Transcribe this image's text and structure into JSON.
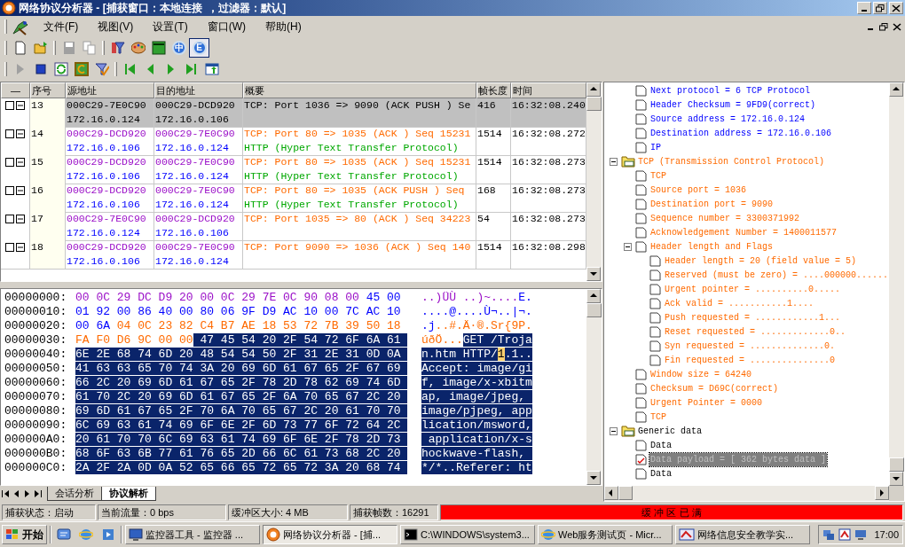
{
  "window": {
    "title": "网络协议分析器 - [捕获窗口：本地连接  ，过滤器：默认]"
  },
  "menu": [
    "文件(F)",
    "视图(V)",
    "设置(T)",
    "窗口(W)",
    "帮助(H)"
  ],
  "toolbar1": [
    [
      {
        "kind": "new",
        "disabled": false,
        "pressed": false
      },
      {
        "kind": "open",
        "disabled": false,
        "pressed": false
      }
    ],
    [
      {
        "kind": "save",
        "disabled": true,
        "pressed": false
      },
      {
        "kind": "copy",
        "disabled": true,
        "pressed": false
      }
    ],
    [
      {
        "kind": "filter",
        "disabled": false,
        "pressed": false
      },
      {
        "kind": "palette",
        "disabled": false,
        "pressed": false
      },
      {
        "kind": "monitor",
        "disabled": false,
        "pressed": false
      },
      {
        "kind": "lang",
        "label": "中",
        "disabled": false,
        "pressed": false
      },
      {
        "kind": "lang",
        "label": "E",
        "disabled": false,
        "pressed": true
      }
    ]
  ],
  "toolbar2": [
    [
      {
        "kind": "play",
        "disabled": true
      },
      {
        "kind": "stop",
        "disabled": false
      },
      {
        "kind": "refresh",
        "disabled": false
      },
      {
        "kind": "restart",
        "disabled": false
      },
      {
        "kind": "filter-check",
        "disabled": false
      }
    ],
    [
      {
        "kind": "first",
        "disabled": false
      },
      {
        "kind": "prev",
        "disabled": false
      },
      {
        "kind": "next",
        "disabled": false
      },
      {
        "kind": "last",
        "disabled": false
      },
      {
        "kind": "export",
        "disabled": false
      }
    ]
  ],
  "table": {
    "columns": [
      "—",
      "序号",
      "源地址",
      "目的地址",
      "概要",
      "帧长度",
      "时间"
    ],
    "rows": [
      {
        "selected": true,
        "checked": false,
        "expanded": true,
        "no": "13",
        "src_mac": "000C29-7E0C90",
        "src_ip": "172.16.0.124",
        "dst_mac": "000C29-DCD920",
        "dst_ip": "172.16.0.106",
        "summary": [
          {
            "kind": "tcp",
            "text": "TCP: Port 1036 => 9090 (ACK PUSH ) Se"
          }
        ],
        "length": "416",
        "time": "16:32:08.240"
      },
      {
        "selected": false,
        "checked": false,
        "expanded": true,
        "no": "14",
        "src_mac": "000C29-DCD920",
        "src_ip": "172.16.0.106",
        "dst_mac": "000C29-7E0C90",
        "dst_ip": "172.16.0.124",
        "summary": [
          {
            "kind": "tcp",
            "text": "TCP: Port 80 => 1035 (ACK ) Seq 15231"
          },
          {
            "kind": "http",
            "text": "HTTP (Hyper Text Transfer Protocol)"
          }
        ],
        "length": "1514",
        "time": "16:32:08.272"
      },
      {
        "selected": false,
        "checked": false,
        "expanded": true,
        "no": "15",
        "src_mac": "000C29-DCD920",
        "src_ip": "172.16.0.106",
        "dst_mac": "000C29-7E0C90",
        "dst_ip": "172.16.0.124",
        "summary": [
          {
            "kind": "tcp",
            "text": "TCP: Port 80 => 1035 (ACK ) Seq 15231"
          },
          {
            "kind": "http",
            "text": "HTTP (Hyper Text Transfer Protocol)"
          }
        ],
        "length": "1514",
        "time": "16:32:08.273"
      },
      {
        "selected": false,
        "checked": false,
        "expanded": true,
        "no": "16",
        "src_mac": "000C29-DCD920",
        "src_ip": "172.16.0.106",
        "dst_mac": "000C29-7E0C90",
        "dst_ip": "172.16.0.124",
        "summary": [
          {
            "kind": "tcp",
            "text": "TCP: Port 80 => 1035 (ACK PUSH ) Seq"
          },
          {
            "kind": "http",
            "text": "HTTP (Hyper Text Transfer Protocol)"
          }
        ],
        "length": "168",
        "time": "16:32:08.273"
      },
      {
        "selected": false,
        "checked": false,
        "expanded": true,
        "no": "17",
        "src_mac": "000C29-7E0C90",
        "src_ip": "172.16.0.124",
        "dst_mac": "000C29-DCD920",
        "dst_ip": "172.16.0.106",
        "summary": [
          {
            "kind": "tcp",
            "text": "TCP: Port 1035 => 80 (ACK ) Seq 34223"
          }
        ],
        "length": "54",
        "time": "16:32:08.273"
      },
      {
        "selected": false,
        "checked": false,
        "expanded": true,
        "no": "18",
        "src_mac": "000C29-DCD920",
        "src_ip": "172.16.0.106",
        "dst_mac": "000C29-7E0C90",
        "dst_ip": "172.16.0.124",
        "summary": [
          {
            "kind": "tcp",
            "text": "TCP: Port 9090 => 1036 (ACK ) Seq 140"
          }
        ],
        "length": "1514",
        "time": "16:32:08.298"
      }
    ]
  },
  "hex": [
    {
      "offset": "00000000:",
      "bytes": [
        {
          "kind": "eth",
          "text": "00 0C 29 DC D9 20 00 0C 29 7E 0C 90 08 00"
        },
        {
          "kind": "ip",
          "text": "45 00"
        }
      ],
      "ascii": [
        {
          "kind": "eth",
          "text": "..)ÜÙ ..)~...."
        },
        {
          "kind": "ip",
          "text": "E."
        }
      ]
    },
    {
      "offset": "00000010:",
      "bytes": [
        {
          "kind": "ip",
          "text": "01 92 00 86 40 00 80 06 9F D9 AC 10 00 7C AC 10"
        }
      ],
      "ascii": [
        {
          "kind": "ip",
          "text": "....@....Ù¬..|¬."
        }
      ]
    },
    {
      "offset": "00000020:",
      "bytes": [
        {
          "kind": "ip",
          "text": "00 6A"
        },
        {
          "kind": "tcp",
          "text": "04 0C 23 82 C4 B7 AE 18 53 72 7B 39 50 18"
        }
      ],
      "ascii": [
        {
          "kind": "ip",
          "text": ".j"
        },
        {
          "kind": "tcp",
          "text": "..#.Ä·®.Sr{9P."
        }
      ]
    },
    {
      "offset": "00000030:",
      "bytes": [
        {
          "kind": "tcp",
          "text": "FA F0 D6 9C 00 00"
        },
        {
          "kind": "selected",
          "text": "47 45 54 20 2F 54 72 6F 6A 61"
        }
      ],
      "ascii": [
        {
          "kind": "tcp",
          "text": "úðÖ..."
        },
        {
          "kind": "selected",
          "text": "GET /Troja"
        }
      ]
    },
    {
      "offset": "00000040:",
      "bytes": [
        {
          "kind": "selected",
          "text": "6E 2E 68 74 6D 20 48 54 54 50 2F 31 2E 31 0D 0A"
        }
      ],
      "ascii": [
        {
          "kind": "selected",
          "text": "n.htm HTTP/"
        },
        {
          "kind": "cursor",
          "text": "1"
        },
        {
          "kind": "selected",
          "text": ".1.."
        }
      ]
    },
    {
      "offset": "00000050:",
      "bytes": [
        {
          "kind": "selected",
          "text": "41 63 63 65 70 74 3A 20 69 6D 61 67 65 2F 67 69"
        }
      ],
      "ascii": [
        {
          "kind": "selected",
          "text": "Accept: image/gi"
        }
      ]
    },
    {
      "offset": "00000060:",
      "bytes": [
        {
          "kind": "selected",
          "text": "66 2C 20 69 6D 61 67 65 2F 78 2D 78 62 69 74 6D"
        }
      ],
      "ascii": [
        {
          "kind": "selected",
          "text": "f, image/x-xbitm"
        }
      ]
    },
    {
      "offset": "00000070:",
      "bytes": [
        {
          "kind": "selected",
          "text": "61 70 2C 20 69 6D 61 67 65 2F 6A 70 65 67 2C 20"
        }
      ],
      "ascii": [
        {
          "kind": "selected",
          "text": "ap, image/jpeg, "
        }
      ]
    },
    {
      "offset": "00000080:",
      "bytes": [
        {
          "kind": "selected",
          "text": "69 6D 61 67 65 2F 70 6A 70 65 67 2C 20 61 70 70"
        }
      ],
      "ascii": [
        {
          "kind": "selected",
          "text": "image/pjpeg, app"
        }
      ]
    },
    {
      "offset": "00000090:",
      "bytes": [
        {
          "kind": "selected",
          "text": "6C 69 63 61 74 69 6F 6E 2F 6D 73 77 6F 72 64 2C"
        }
      ],
      "ascii": [
        {
          "kind": "selected",
          "text": "lication/msword,"
        }
      ]
    },
    {
      "offset": "000000A0:",
      "bytes": [
        {
          "kind": "selected",
          "text": "20 61 70 70 6C 69 63 61 74 69 6F 6E 2F 78 2D 73"
        }
      ],
      "ascii": [
        {
          "kind": "selected",
          "text": " application/x-s"
        }
      ]
    },
    {
      "offset": "000000B0:",
      "bytes": [
        {
          "kind": "selected",
          "text": "68 6F 63 6B 77 61 76 65 2D 66 6C 61 73 68 2C 20"
        }
      ],
      "ascii": [
        {
          "kind": "selected",
          "text": "hockwave-flash, "
        }
      ]
    },
    {
      "offset": "000000C0:",
      "bytes": [
        {
          "kind": "selected",
          "text": "2A 2F 2A 0D 0A 52 65 66 65 72 65 72 3A 20 68 74"
        }
      ],
      "ascii": [
        {
          "kind": "selected",
          "text": "*/*..Referer: ht"
        }
      ]
    }
  ],
  "view_tabs": [
    {
      "label": "会话分析",
      "selected": false
    },
    {
      "label": "协议解析",
      "selected": true
    }
  ],
  "tree": [
    {
      "kind": "ip",
      "children": [
        {
          "label": "Next protocol = 6 TCP Protocol"
        },
        {
          "label": "Header Checksum = 9FD9(correct)"
        },
        {
          "label": "Source address = 172.16.0.124"
        },
        {
          "label": "Destination address = 172.16.0.106"
        },
        {
          "label": "IP"
        }
      ]
    },
    {
      "kind": "tcp",
      "label": "TCP (Transmission Control Protocol)",
      "expanded": true,
      "children": [
        {
          "label": "TCP"
        },
        {
          "label": "Source port = 1036"
        },
        {
          "label": "Destination port = 9090"
        },
        {
          "label": "Sequence number = 3300371992"
        },
        {
          "label": "Acknowledgement Number = 1400011577"
        },
        {
          "label": "Header length and Flags",
          "expanded": true,
          "children": [
            {
              "label": "Header length = 20 (field value = 5)"
            },
            {
              "label": "Reserved (must be zero) = ....000000......"
            },
            {
              "label": "Urgent pointer = ..........0....."
            },
            {
              "label": "Ack valid = ...........1...."
            },
            {
              "label": "Push requested = ............1..."
            },
            {
              "label": "Reset requested = .............0.."
            },
            {
              "label": "Syn requested = ..............0."
            },
            {
              "label": "Fin requested = ...............0"
            }
          ]
        },
        {
          "label": "Window size = 64240"
        },
        {
          "label": "Checksum = D69C(correct)"
        },
        {
          "label": "Urgent Pointer = 0000"
        },
        {
          "label": "TCP"
        }
      ]
    },
    {
      "kind": "data",
      "label": "Generic data",
      "expanded": true,
      "children": [
        {
          "label": "Data",
          "selected": false
        },
        {
          "label": "Data payload = [ 362 bytes data ]",
          "selected": true
        },
        {
          "label": "Data",
          "selected": false
        }
      ]
    }
  ],
  "status_bar": {
    "state": "捕获状态：启动",
    "traffic": "当前流量：0 bps",
    "buffer": "缓冲区大小: 4 MB",
    "frames": "捕获帧数：16291",
    "alert": "缓 冲 区 已 满"
  },
  "taskbar": {
    "start": "开始",
    "quick_launch": [
      {
        "kind": "desktop"
      },
      {
        "kind": "ie"
      },
      {
        "kind": "media"
      }
    ],
    "tasks": [
      {
        "kind": "monitor",
        "label": "监控器工具 - 监控器 ...",
        "selected": false
      },
      {
        "kind": "app",
        "label": "网络协议分析器 - [捕...",
        "selected": true
      },
      {
        "kind": "console",
        "label": "C:\\WINDOWS\\system3...",
        "selected": false
      },
      {
        "kind": "ie",
        "label": "Web服务测试页 - Micr...",
        "selected": false
      },
      {
        "kind": "nis",
        "label": "网络信息安全教学实...",
        "selected": false
      }
    ],
    "clock": "17:00"
  }
}
